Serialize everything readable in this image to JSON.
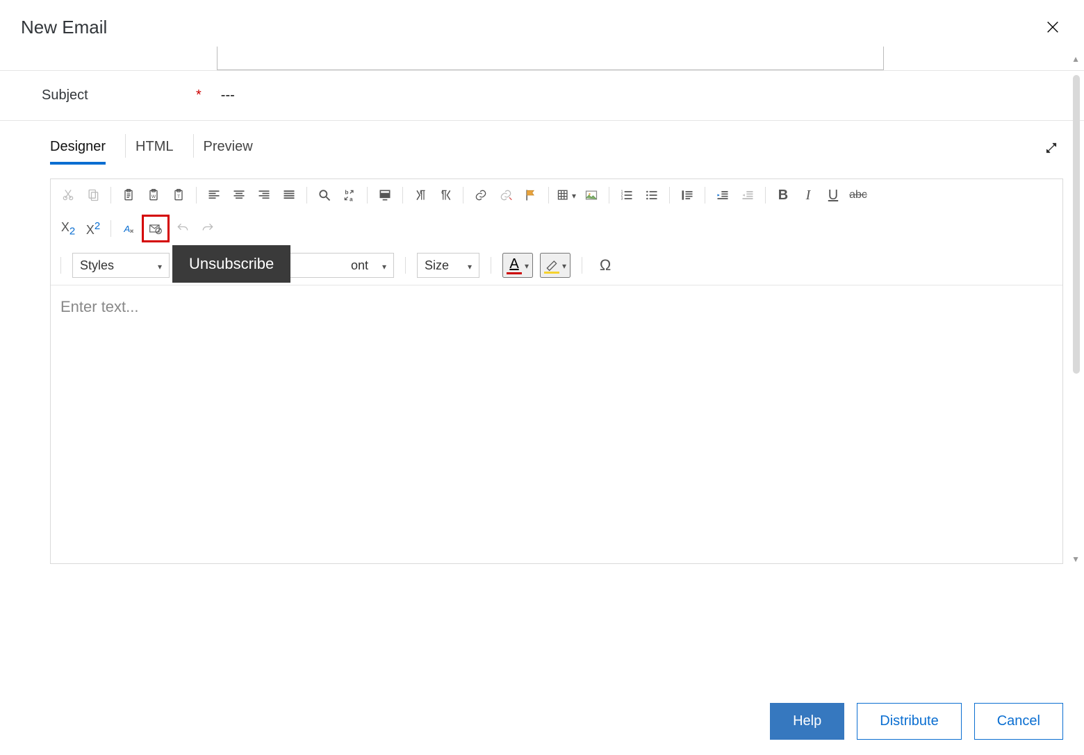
{
  "header": {
    "title": "New Email"
  },
  "subject": {
    "label": "Subject",
    "required": "*",
    "value": "---"
  },
  "tabs": {
    "designer": "Designer",
    "html": "HTML",
    "preview": "Preview",
    "active": "designer"
  },
  "toolbar": {
    "styles_label": "Styles",
    "font_label": "ont",
    "size_label": "Size",
    "tooltip": "Unsubscribe"
  },
  "editor": {
    "placeholder": "Enter text..."
  },
  "footer": {
    "help": "Help",
    "distribute": "Distribute",
    "cancel": "Cancel"
  }
}
